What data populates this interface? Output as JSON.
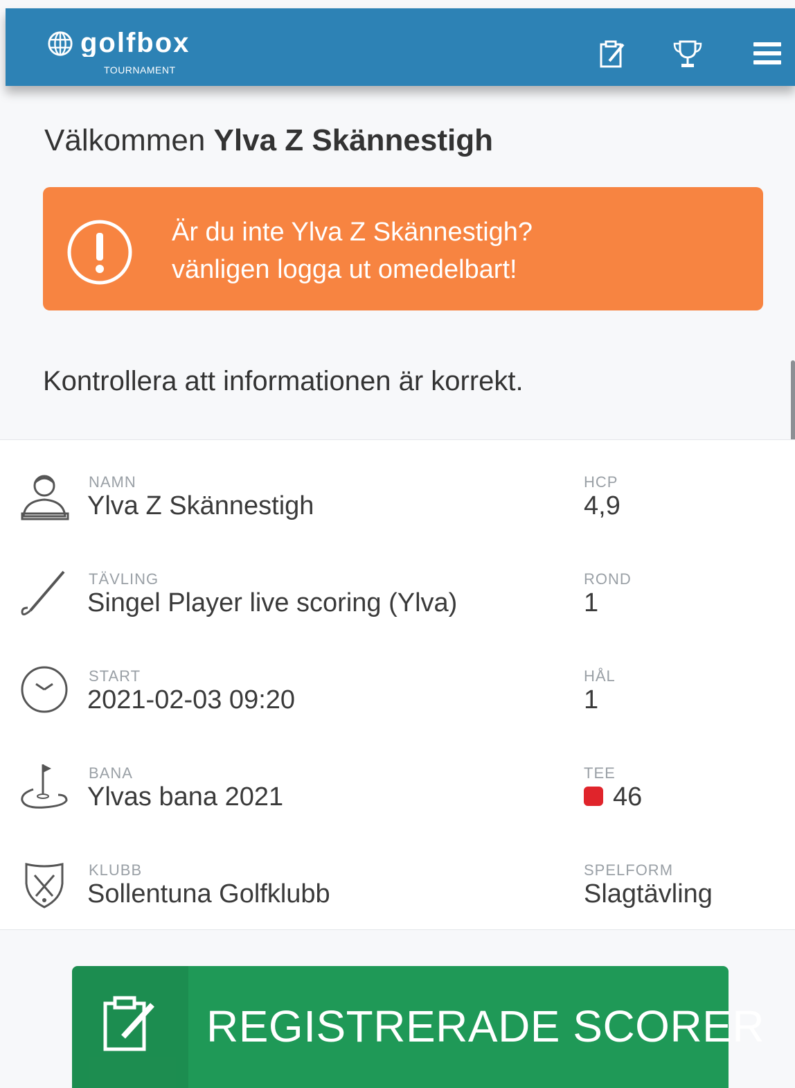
{
  "header": {
    "logo_word": "Golfbox",
    "logo_sub": "TOURNAMENT",
    "icons": [
      "edit-scorecard-icon",
      "trophy-icon",
      "hamburger-menu-icon"
    ],
    "color": "#2d82b5"
  },
  "welcome": {
    "greeting": "Välkommen",
    "name": "Ylva Z Skännestigh"
  },
  "alert": {
    "line1": "Är du inte Ylva Z Skännestigh?",
    "line2": "vänligen logga ut omedelbart!",
    "color": "#f78441",
    "icon": "exclamation-circle-icon"
  },
  "instruction": "Kontrollera att informationen är korrekt.",
  "info": {
    "name_label": "NAMN",
    "name_value": "Ylva Z Skännestigh",
    "hcp_label": "HCP",
    "hcp_value": "4,9",
    "competition_label": "TÄVLING",
    "competition_value": "Singel Player live scoring (Ylva)",
    "round_label": "ROND",
    "round_value": "1",
    "start_label": "START",
    "start_value": "2021-02-03 09:20",
    "hole_label": "HÅL",
    "hole_value": "1",
    "course_label": "BANA",
    "course_value": "Ylvas bana 2021",
    "tee_label": "TEE",
    "tee_value": "46",
    "tee_color": "#e0242b",
    "club_label": "KLUBB",
    "club_value": "Sollentuna Golfklubb",
    "format_label": "SPELFORM",
    "format_value": "Slagtävling"
  },
  "button": {
    "label": "REGISTRERADE SCORER",
    "color": "#1f9957",
    "icon": "scorecard-edit-icon"
  }
}
